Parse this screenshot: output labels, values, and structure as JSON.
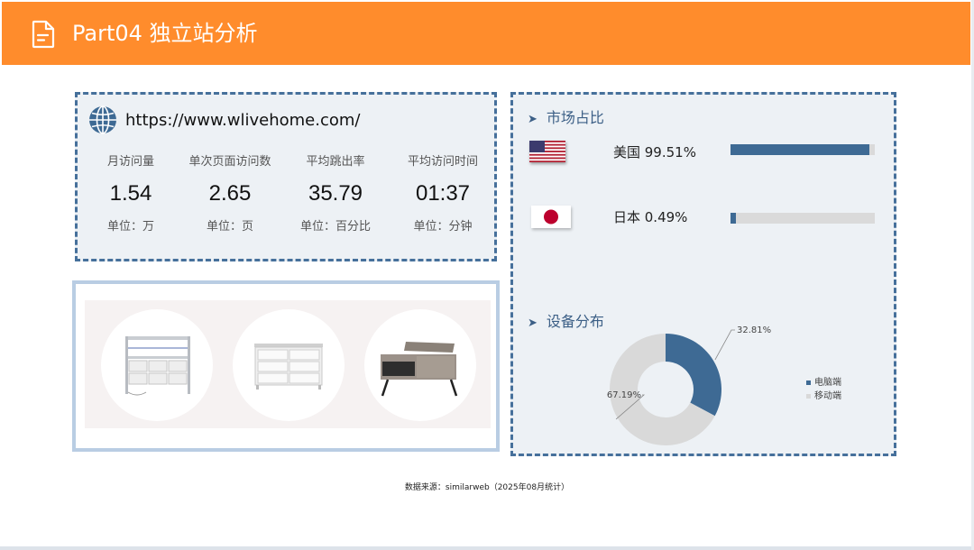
{
  "header": {
    "title": "Part04 独立站分析",
    "icon": "document-icon",
    "color": "#ff8c2c"
  },
  "site": {
    "icon": "globe-icon",
    "url": "https://www.wlivehome.com/",
    "metrics": [
      {
        "label": "月访问量",
        "value": "1.54",
        "unit": "单位：万"
      },
      {
        "label": "单次页面访问数",
        "value": "2.65",
        "unit": "单位：页"
      },
      {
        "label": "平均跳出率",
        "value": "35.79",
        "unit": "单位：百分比"
      },
      {
        "label": "平均访问时间",
        "value": "01:37",
        "unit": "单位：分钟"
      }
    ]
  },
  "market": {
    "title": "市场占比",
    "items": [
      {
        "flag": "us-flag-icon",
        "label": "美国 99.51%",
        "share": 0.9951
      },
      {
        "flag": "japan-flag-icon",
        "label": "日本 0.49%",
        "share": 0.0049
      }
    ],
    "bar_color": "#3e6a94",
    "track_color": "#dadada"
  },
  "device": {
    "title": "设备分布",
    "chart_data": {
      "type": "pie",
      "donut": true,
      "categories": [
        "电脑端",
        "移动端"
      ],
      "values": [
        32.81,
        67.19
      ],
      "data_labels": [
        "32.81%",
        "67.19%"
      ],
      "colors": [
        "#3e6a94",
        "#d9d9d9"
      ],
      "legend": "right"
    }
  },
  "products": {
    "items": [
      {
        "icon": "storage-shelf-icon"
      },
      {
        "icon": "dresser-icon"
      },
      {
        "icon": "lift-top-coffee-table-icon"
      }
    ]
  },
  "footer": {
    "source": "数据来源：similarweb（2025年08月统计）"
  }
}
